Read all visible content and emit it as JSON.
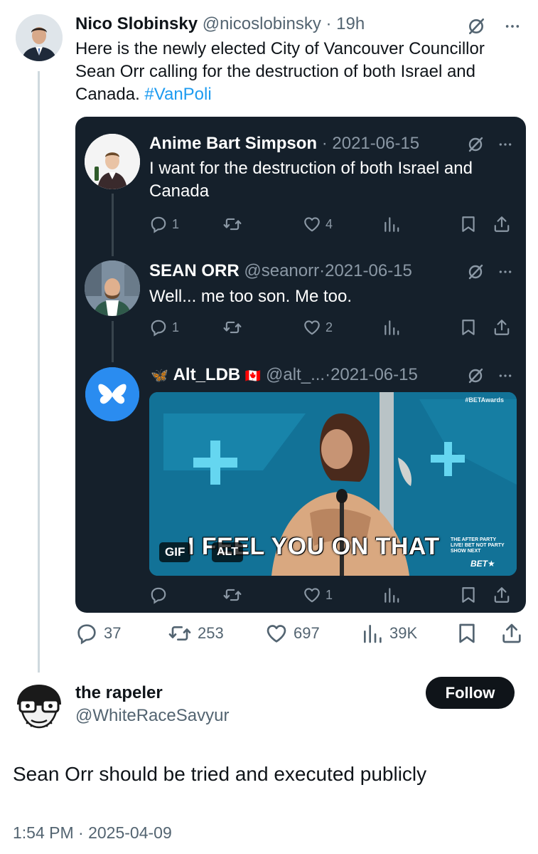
{
  "parent_tweet": {
    "display_name": "Nico Slobinsky",
    "handle": "@nicoslobinsky",
    "separator": "·",
    "time": "19h",
    "text": "Here is the newly elected City of Vancouver Councillor Sean Orr calling for the destruction of both Israel and Canada. ",
    "hashtag": "#VanPoli",
    "stats": {
      "replies": "37",
      "reposts": "253",
      "likes": "697",
      "views": "39K"
    }
  },
  "quoted_thread": [
    {
      "display_name": "Anime Bart Simpson",
      "separator": "·",
      "date": "2021-06-15",
      "text": "I want for the destruction of both Israel and Canada",
      "stats": {
        "replies": "1",
        "reposts": "",
        "likes": "4"
      }
    },
    {
      "display_name": "SEAN ORR",
      "handle": "@seanorr",
      "separator": "·",
      "date": "2021-06-15",
      "text": "Well... me too son. Me too.",
      "stats": {
        "replies": "1",
        "reposts": "",
        "likes": "2"
      }
    },
    {
      "butterfly": "🦋",
      "display_name": "Alt_LDB",
      "flag": "🇨🇦",
      "handle": "@alt_...",
      "separator": "·",
      "date": "2021-06-15",
      "media": {
        "caption": "I FEEL YOU ON THAT",
        "gif_badge": "GIF",
        "alt_badge": "ALT",
        "watermark_top": "#BETAwards",
        "watermark_side": "THE AFTER PARTY LIVE! BET NOT PARTY SHOW NEXT",
        "network_logo": "BET★"
      },
      "stats": {
        "replies": "",
        "reposts": "",
        "likes": "1"
      }
    }
  ],
  "reply": {
    "display_name": "the rapeler",
    "handle": "@WhiteRaceSavyur",
    "follow_label": "Follow",
    "text": "Sean Orr should be tried and executed publicly",
    "timestamp": "1:54 PM · 2025-04-09"
  },
  "icons": [
    "grok-icon",
    "more-icon",
    "reply-icon",
    "repost-icon",
    "like-icon",
    "views-icon",
    "bookmark-icon",
    "share-icon"
  ],
  "colors": {
    "link": "#1d9bf0",
    "card_bg": "#15202b",
    "muted": "#536471",
    "follow_bg": "#0f1419"
  }
}
